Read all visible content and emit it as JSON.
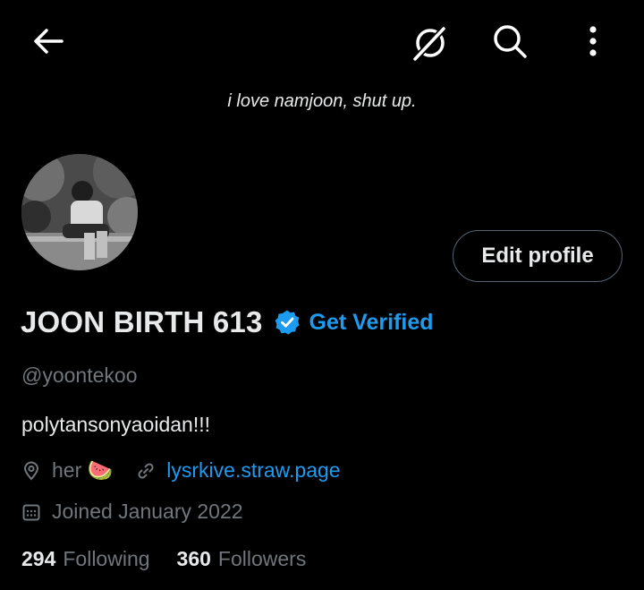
{
  "header": {
    "banner_text": "i love namjoon, shut up.",
    "icons": [
      "back-arrow-icon",
      "grok-icon",
      "search-icon",
      "more-options-icon"
    ]
  },
  "profile": {
    "display_name": "JOON BIRTH 613",
    "get_verified_label": "Get Verified",
    "handle": "@yoontekoo",
    "bio": "polytansonyaoidan!!!",
    "location": "her 🍉",
    "website": "lysrkive.straw.page",
    "joined": "Joined January 2022",
    "following_count": "294",
    "following_label": "Following",
    "followers_count": "360",
    "followers_label": "Followers"
  },
  "actions": {
    "edit_profile_label": "Edit profile"
  },
  "colors": {
    "background": "#000000",
    "text_primary": "#e7e9ea",
    "text_secondary": "#71767b",
    "accent": "#1d9bf0",
    "border": "#536471"
  }
}
